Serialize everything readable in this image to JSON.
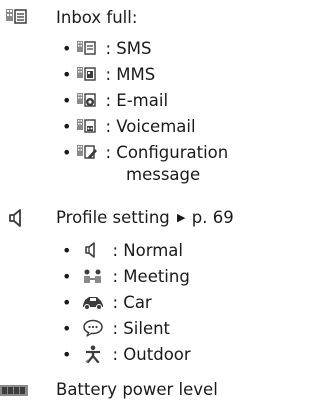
{
  "inbox": {
    "icon": "inbox-full-icon",
    "title": "Inbox full:",
    "items": [
      {
        "icon": "sms-icon",
        "label": ": SMS"
      },
      {
        "icon": "mms-icon",
        "label": ": MMS"
      },
      {
        "icon": "email-icon",
        "label": ": E-mail"
      },
      {
        "icon": "voicemail-icon",
        "label": ": Voicemail"
      },
      {
        "icon": "configuration-icon",
        "label": ": Configuration",
        "label_cont": "message"
      }
    ]
  },
  "profile": {
    "icon": "speaker-icon",
    "title": "Profile setting",
    "arrow": "▶",
    "page_ref": "p. 69",
    "items": [
      {
        "icon": "normal-speaker-icon",
        "label": ": Normal"
      },
      {
        "icon": "meeting-icon",
        "label": ": Meeting"
      },
      {
        "icon": "car-icon",
        "label": ": Car"
      },
      {
        "icon": "silent-icon",
        "label": ": Silent"
      },
      {
        "icon": "outdoor-icon",
        "label": ": Outdoor"
      }
    ]
  },
  "battery": {
    "icon": "battery-icon",
    "title": "Battery power level"
  },
  "colors": {
    "icon_gray": "#8a8a8a",
    "icon_dark": "#3c3c3c",
    "text": "#1a1a1a"
  }
}
